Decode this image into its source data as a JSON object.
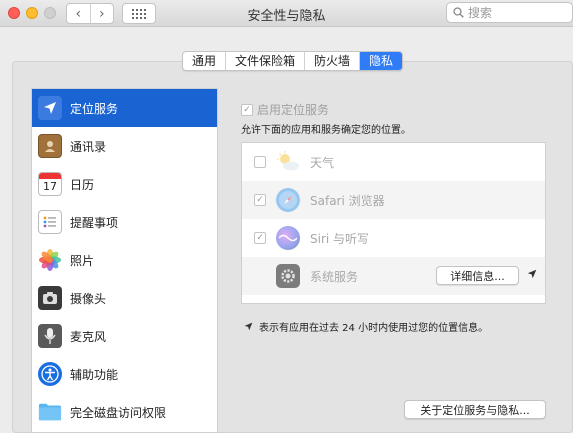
{
  "window": {
    "title": "安全性与隐私"
  },
  "toolbar": {
    "back": "‹",
    "forward": "›",
    "search_placeholder": "搜索"
  },
  "tabs": [
    {
      "label": "通用",
      "active": false
    },
    {
      "label": "文件保险箱",
      "active": false
    },
    {
      "label": "防火墙",
      "active": false
    },
    {
      "label": "隐私",
      "active": true
    }
  ],
  "sidebar": {
    "items": [
      {
        "label": "定位服务",
        "icon": "location-arrow-icon",
        "active": true
      },
      {
        "label": "通讯录",
        "icon": "contacts-book-icon",
        "active": false
      },
      {
        "label": "日历",
        "icon": "calendar-icon",
        "day": "17",
        "active": false
      },
      {
        "label": "提醒事项",
        "icon": "reminders-icon",
        "active": false
      },
      {
        "label": "照片",
        "icon": "photos-icon",
        "active": false
      },
      {
        "label": "摄像头",
        "icon": "camera-icon",
        "active": false
      },
      {
        "label": "麦克风",
        "icon": "microphone-icon",
        "active": false
      },
      {
        "label": "辅助功能",
        "icon": "accessibility-icon",
        "active": false
      },
      {
        "label": "完全磁盘访问权限",
        "icon": "folder-icon",
        "active": false
      }
    ]
  },
  "location": {
    "enable_label": "启用定位服务",
    "enabled": true,
    "description": "允许下面的应用和服务确定您的位置。",
    "apps": [
      {
        "name": "天气",
        "checked": false,
        "icon": "weather-icon"
      },
      {
        "name": "Safari 浏览器",
        "checked": true,
        "icon": "safari-icon"
      },
      {
        "name": "Siri 与听写",
        "checked": true,
        "icon": "siri-icon"
      },
      {
        "name": "系统服务",
        "checked": null,
        "icon": "gear-icon",
        "button": "详细信息..."
      }
    ],
    "note": "表示有应用在过去 24 小时内使用过您的位置信息。",
    "about_button": "关于定位服务与隐私..."
  }
}
